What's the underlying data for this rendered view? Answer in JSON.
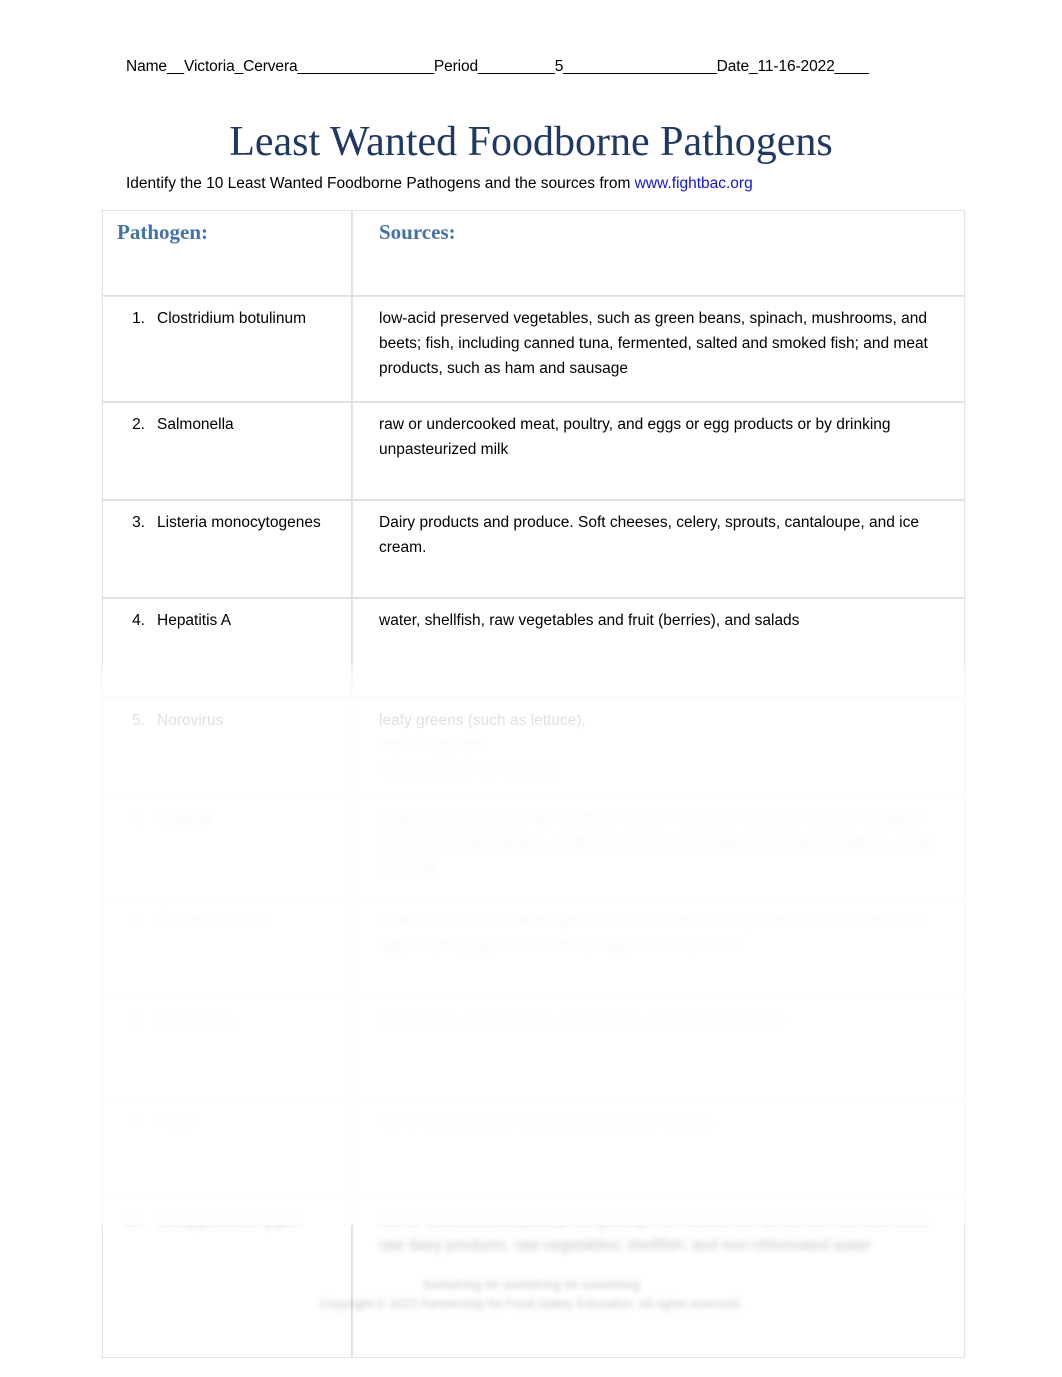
{
  "header_line": {
    "text": "Name__Victoria_Cervera________________Period_________5__________________Date_11-16-2022____",
    "name_label": "Name",
    "name_value": "Victoria_Cervera",
    "period_label": "Period",
    "period_value": "5",
    "date_label": "Date",
    "date_value": "11-16-2022"
  },
  "title": "Least Wanted Foodborne Pathogens",
  "subtitle": {
    "prefix": "Identify the 10 Least Wanted Foodborne Pathogens and the sources from ",
    "link_text": "www.fightbac.org"
  },
  "table": {
    "headers": {
      "pathogen": "Pathogen:",
      "sources": "Sources:"
    },
    "rows": [
      {
        "num": "1.",
        "pathogen": "Clostridium botulinum",
        "sources": "low-acid preserved vegetables, such as green beans, spinach, mushrooms, and beets; fish, including canned tuna, fermented, salted and smoked fish; and meat products, such as ham and sausage",
        "obscured": false
      },
      {
        "num": "2.",
        "pathogen": "Salmonella",
        "sources": "raw or undercooked meat, poultry, and eggs or egg products or by drinking unpasteurized milk",
        "obscured": false
      },
      {
        "num": "3.",
        "pathogen": "Listeria monocytogenes",
        "sources": "Dairy products and produce. Soft cheeses, celery, sprouts, cantaloupe, and ice cream.",
        "obscured": false
      },
      {
        "num": "4.",
        "pathogen": "Hepatitis A",
        "sources": "water, shellfish, raw vegetables and fruit (berries), and salads",
        "obscured": false
      },
      {
        "num": "5.",
        "pathogen": "Norovirus",
        "sources": "leafy greens (such as lettuce),",
        "sources_obscured_1": "fresh fruits, and",
        "sources_obscured_2": "shellfish (such as oysters)",
        "obscured": false
      },
      {
        "num": "6.",
        "pathogen": "Shigella",
        "sources": "undercooked shrimp, raw shellfish, celery, macaroni, fruit, and lettuce; chopped turkey, rice, beef, beans, stuffing, mushrooms, potato and poultry, shellfish, meat, and milk",
        "obscured": true
      },
      {
        "num": "7.",
        "pathogen": "Escherichia coli",
        "sources": "It takes a kind food/beverage, direct touch, lettuce, unpasteurized fruit/personal apple cider, yogurt, and cheese, apple/hour raw milk",
        "obscured": true
      },
      {
        "num": "8.",
        "pathogen": "Cyclospora",
        "sources": "raspberries, basil, cilantro, snow peas, and mesclun lettuce",
        "obscured": true
      },
      {
        "num": "9.",
        "pathogen": "Vibrio",
        "sources": "raw or undercooked seafood, particularly oysters",
        "obscured": true
      },
      {
        "num": "10.",
        "pathogen": "Campylobacter jejuni",
        "sources": "raw or undercooked poultry like poultry, from under/raw lamb; raw milk and other raw dairy products; raw vegetables; shellfish; and non-chlorinated water",
        "obscured": true
      }
    ]
  },
  "footer": {
    "line1": "Something for something for something",
    "line2": "Copyright © 2022 Partnership for Food Safety Education. All rights reserved."
  },
  "colors": {
    "title": "#1F3864",
    "table_header": "#4472A8",
    "link": "#1414D8",
    "text": "#000000",
    "border": "#e4e4e4",
    "page_bg": "#ffffff"
  }
}
